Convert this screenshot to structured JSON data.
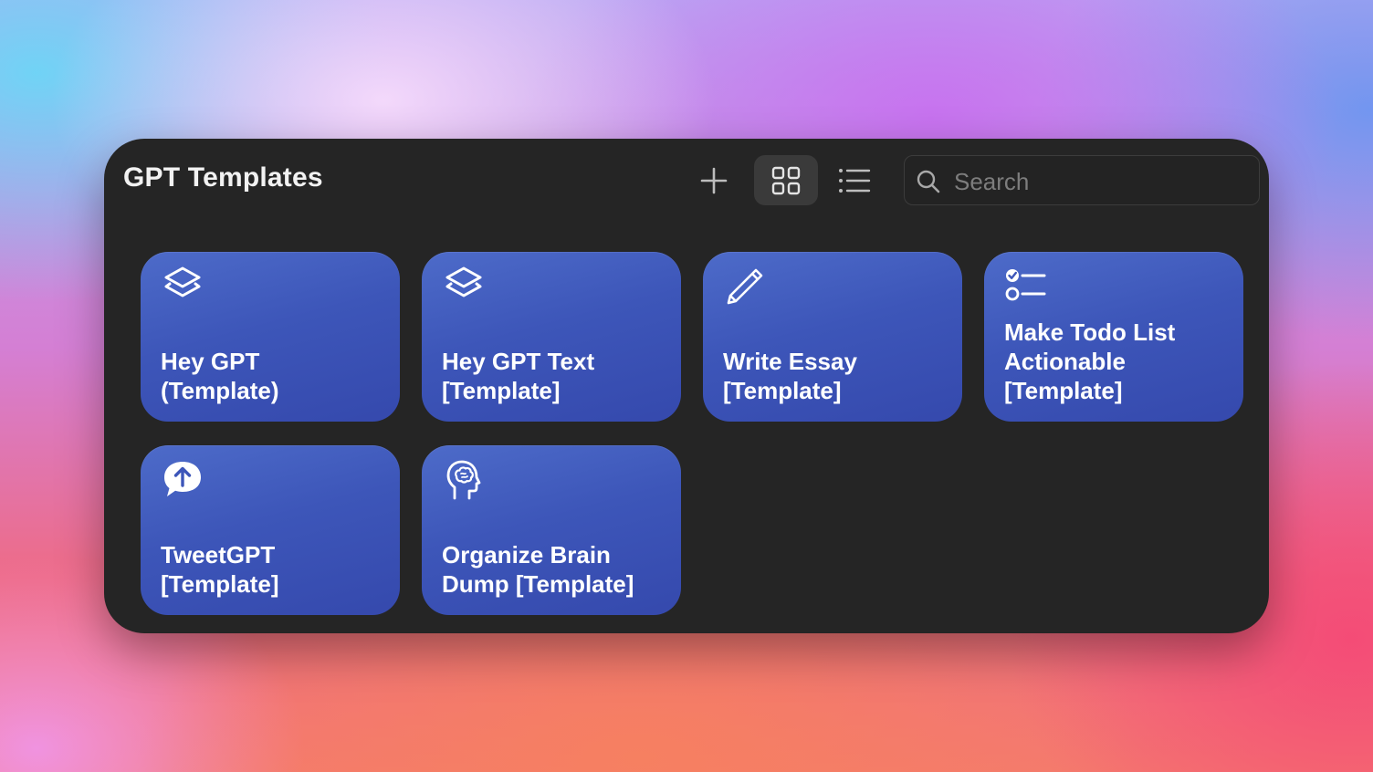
{
  "window": {
    "title": "GPT Templates"
  },
  "toolbar": {
    "add_icon": "plus-icon",
    "grid_view_icon": "grid-icon",
    "list_view_icon": "list-icon",
    "active_view": "grid"
  },
  "search": {
    "placeholder": "Search",
    "value": "",
    "icon": "magnifier-icon"
  },
  "cards": [
    {
      "label": "Hey GPT\n(Template)",
      "icon": "layers-icon"
    },
    {
      "label": "Hey GPT Text\n[Template]",
      "icon": "layers-icon"
    },
    {
      "label": "Write Essay\n[Template]",
      "icon": "pencil-icon"
    },
    {
      "label": "Make Todo List\nActionable\n[Template]",
      "icon": "checklist-icon"
    },
    {
      "label": "TweetGPT\n[Template]",
      "icon": "speech-bubble-upload-icon"
    },
    {
      "label": "Organize Brain\nDump [Template]",
      "icon": "brain-head-icon"
    }
  ],
  "colors": {
    "window_bg": "#252525",
    "card_gradient_top": "#4d6bc9",
    "card_gradient_bottom": "#3549ad",
    "active_toggle_bg": "#3a3a3a",
    "text_primary": "#ffffff"
  }
}
